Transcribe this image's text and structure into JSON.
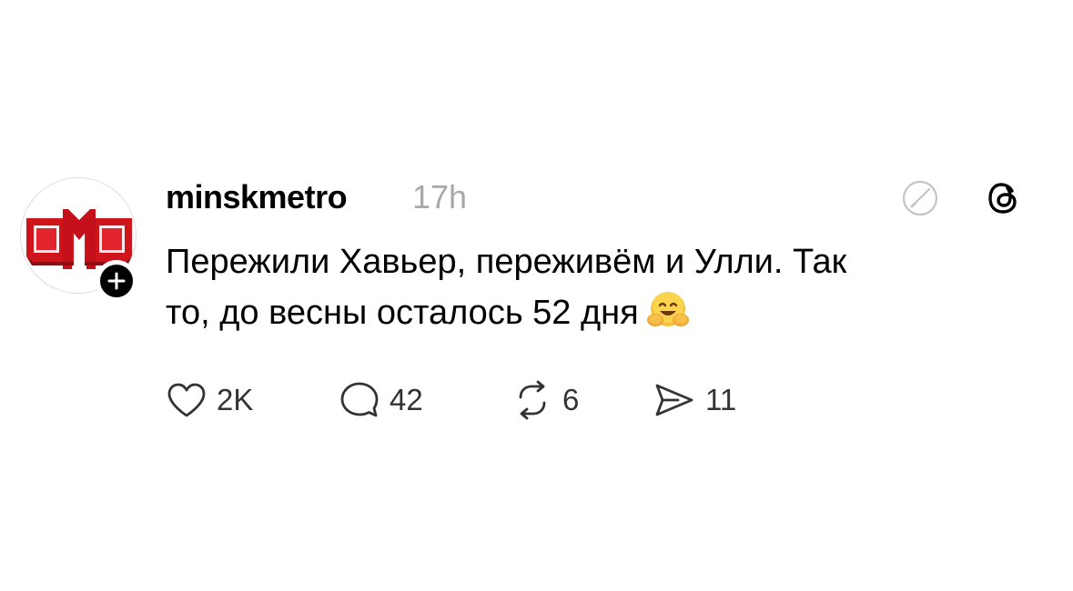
{
  "post": {
    "username": "minskmetro",
    "timestamp": "17h",
    "text_line1": "Пережили Хавьер, переживём и Улли. Так",
    "text_line2": "то, до весны осталось 52 дня",
    "emoji": "hugging-face-emoji"
  },
  "actions": {
    "likes": "2K",
    "replies": "42",
    "reposts": "6",
    "shares": "11"
  },
  "colors": {
    "text": "#000000",
    "muted": "#a8a8a8",
    "logo_red": "#d0141b",
    "badge": "#000000"
  }
}
